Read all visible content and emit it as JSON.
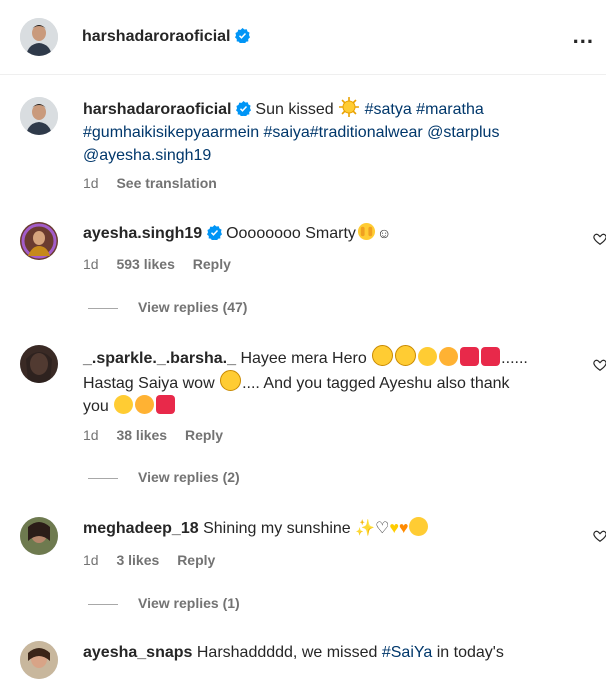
{
  "header": {
    "username": "harshadaroraoficial",
    "more_label": "..."
  },
  "caption": {
    "username": "harshadaroraoficial",
    "text": "Sun kissed",
    "hashtags_line1": "#satya #maratha",
    "hashtags_line2": "#gumhaikisikepyaarmein #saiya#traditionalwear @starplus",
    "mention_line3": "@ayesha.singh19",
    "time": "1d",
    "see_translation": "See translation"
  },
  "comments": [
    {
      "username": "ayesha.singh19",
      "text": "Oooooooo Smarty",
      "time": "1d",
      "likes": "593 likes",
      "reply": "Reply",
      "view_replies": "View replies (47)"
    },
    {
      "username": "_.sparkle._.barsha._",
      "text_line1": "Hayee mera Hero",
      "text_line1_end": "......",
      "text_line2a": "Hastag Saiya wow",
      "text_line2b": ".... And you tagged Ayeshu also thank",
      "text_line3": "you",
      "time": "1d",
      "likes": "38 likes",
      "reply": "Reply",
      "view_replies": "View replies (2)"
    },
    {
      "username": "meghadeep_18",
      "text": "Shining my sunshine",
      "time": "1d",
      "likes": "3 likes",
      "reply": "Reply",
      "view_replies": "View replies (1)"
    },
    {
      "username": "ayesha_snaps",
      "text_a": "Harshaddddd, we missed",
      "hashtag": "#SaiYa",
      "text_b": "in today's"
    }
  ],
  "colors": {
    "text": "#262626",
    "muted": "#737373",
    "link": "#00376b",
    "verified": "#0095f6"
  }
}
